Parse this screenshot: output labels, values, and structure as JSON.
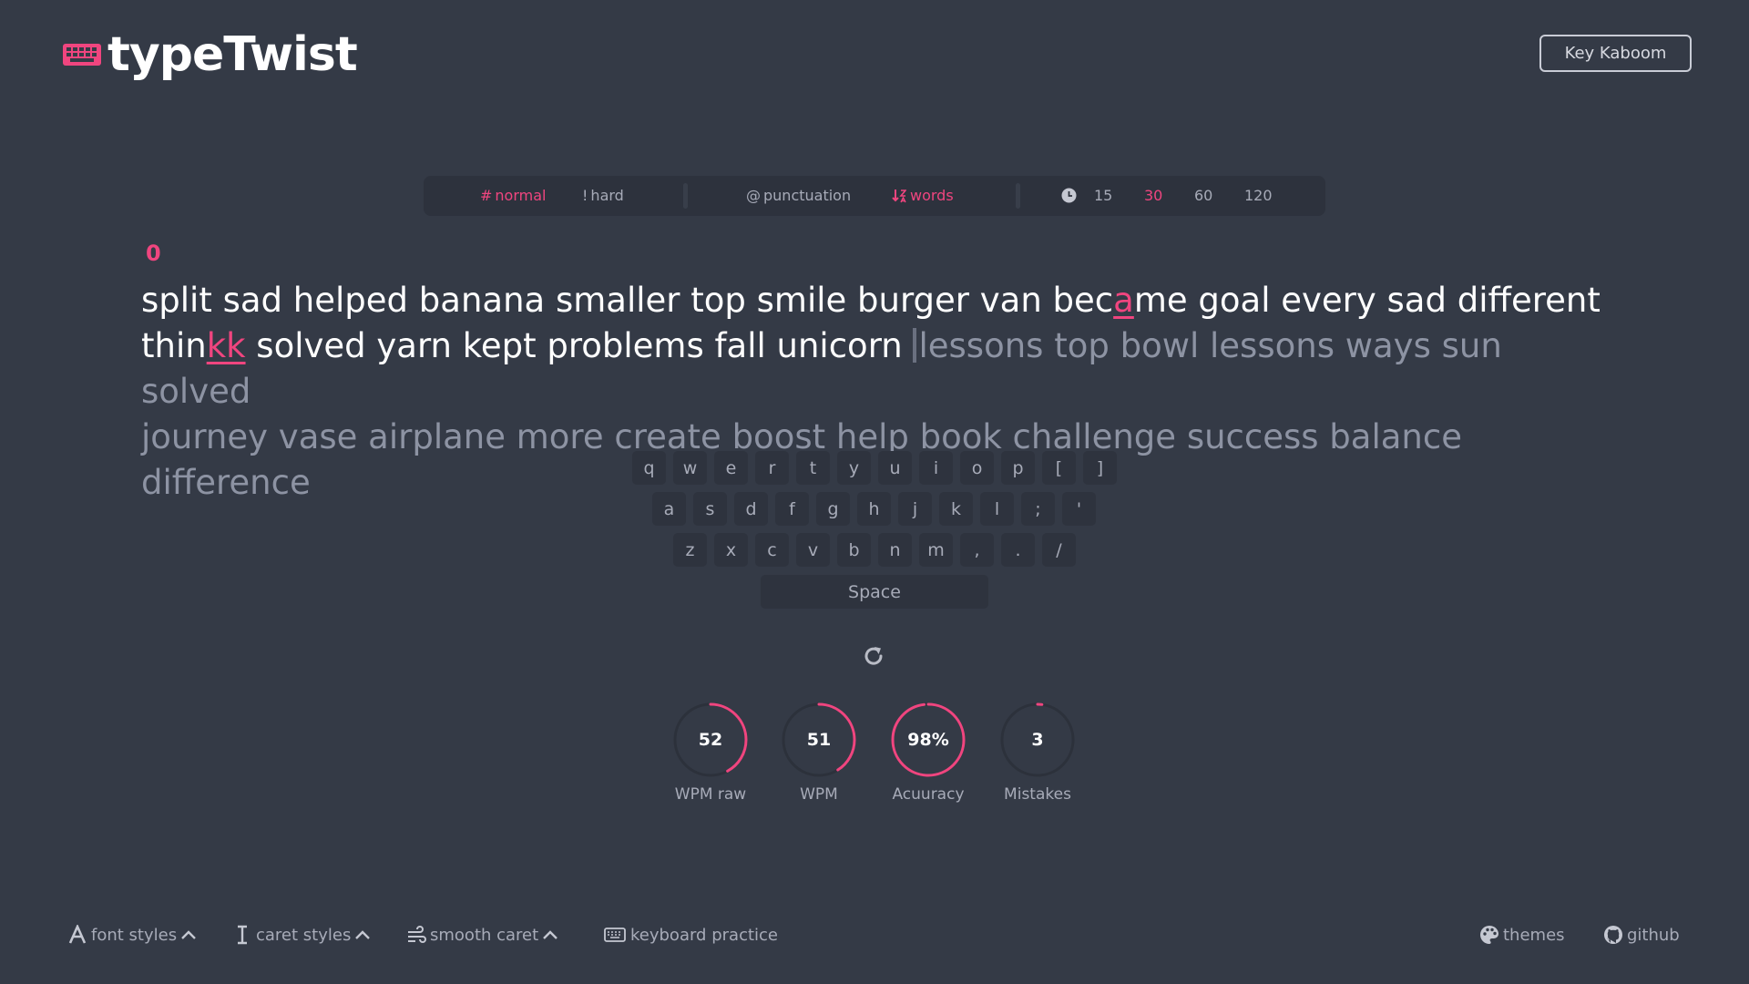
{
  "app": {
    "title": "typeTwist",
    "brand_color": "#f0457f"
  },
  "header": {
    "key_kaboom_label": "Key Kaboom"
  },
  "toolbar": {
    "modes": [
      {
        "symbol": "#",
        "label": "normal",
        "active": true
      },
      {
        "symbol": "!",
        "label": "hard",
        "active": false
      }
    ],
    "options": [
      {
        "symbol": "@",
        "label": "punctuation",
        "active": false
      },
      {
        "icon": "sort-icon",
        "label": "words",
        "active": true
      }
    ],
    "durations": [
      "15",
      "30",
      "60",
      "120"
    ],
    "active_duration": "30"
  },
  "test": {
    "counter": "0",
    "line1": {
      "typed_before": "split sad helped banana smaller top smile burger van bec",
      "error_char": "a",
      "typed_after": "me goal every sad different"
    },
    "line2": {
      "typed_before": "thin",
      "error_extra": "kk",
      "typed_after": " solved yarn kept problems fall unicorn ",
      "upcoming": "lessons top bowl lessons ways sun solved"
    },
    "line3": "journey vase airplane more create boost help book challenge success balance difference"
  },
  "keyboard": {
    "row1": [
      "q",
      "w",
      "e",
      "r",
      "t",
      "y",
      "u",
      "i",
      "o",
      "p",
      "[",
      "]"
    ],
    "row2": [
      "a",
      "s",
      "d",
      "f",
      "g",
      "h",
      "j",
      "k",
      "l",
      ";",
      "'"
    ],
    "row3": [
      "z",
      "x",
      "c",
      "v",
      "b",
      "n",
      "m",
      ",",
      ".",
      "/"
    ],
    "space_label": "Space"
  },
  "stats": [
    {
      "value": "52",
      "label": "WPM raw",
      "progress": 0.42
    },
    {
      "value": "51",
      "label": "WPM",
      "progress": 0.41
    },
    {
      "value": "98%",
      "label": "Acuuracy",
      "progress": 0.98
    },
    {
      "value": "3",
      "label": "Mistakes",
      "progress": 0.02
    }
  ],
  "footer": {
    "font_styles": "font styles",
    "caret_styles": "caret styles",
    "smooth_caret": "smooth caret",
    "keyboard_practice": "keyboard practice",
    "themes": "themes",
    "github": "github"
  }
}
